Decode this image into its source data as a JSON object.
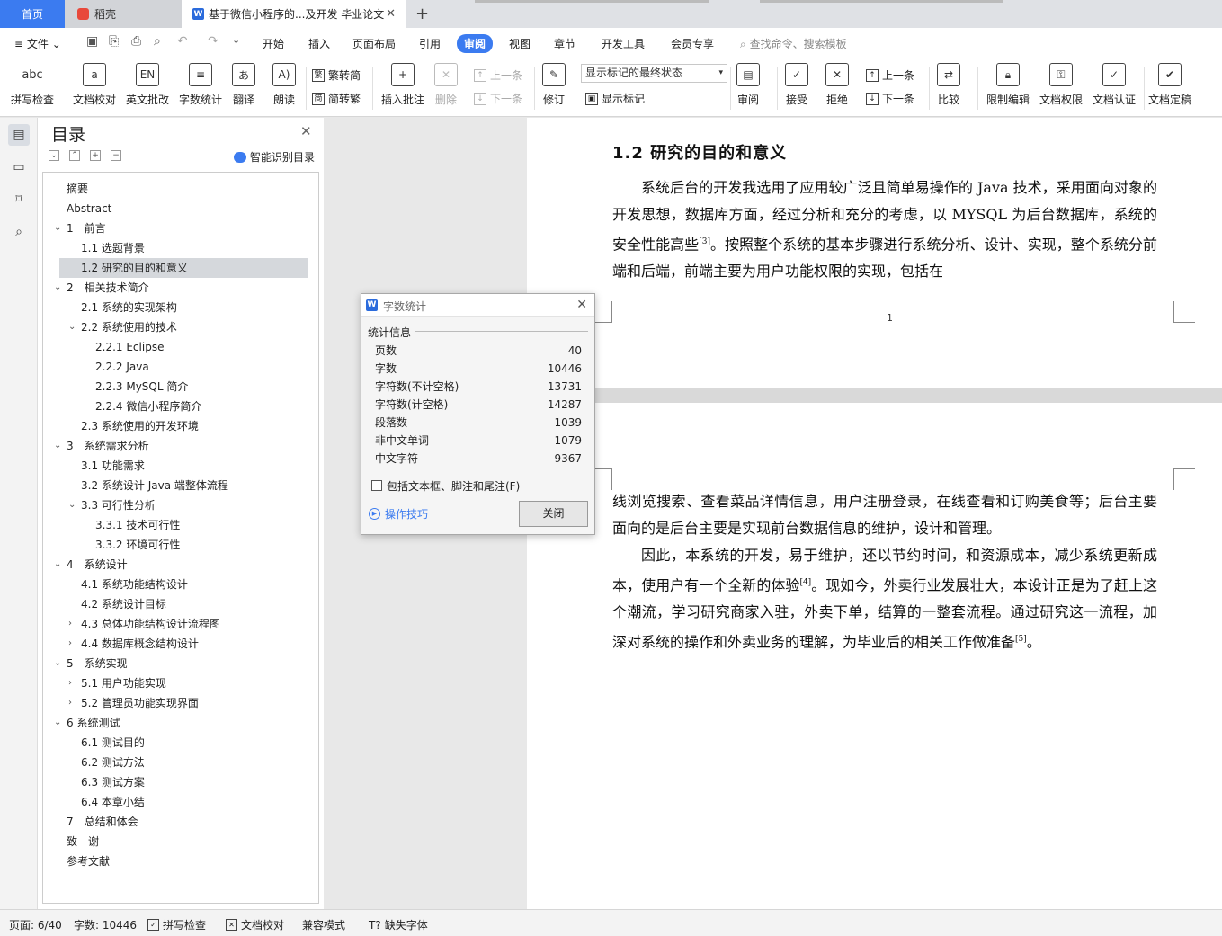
{
  "tabs": {
    "home": "首页",
    "dao": "稻壳",
    "doc": "基于微信小程序的...及开发 毕业论文",
    "plus": "+"
  },
  "menu": {
    "file": "文件",
    "items": [
      "开始",
      "插入",
      "页面布局",
      "引用",
      "审阅",
      "视图",
      "章节",
      "开发工具",
      "会员专享"
    ],
    "active": "审阅",
    "search": "查找命令、搜索模板"
  },
  "ribbon": {
    "spell": "拼写检查",
    "proof": "文档校对",
    "en": "英文批改",
    "count": "字数统计",
    "trans": "翻译",
    "read": "朗读",
    "trad": "繁转简",
    "simp": "简转繁",
    "insert_comment": "插入批注",
    "delete": "删除",
    "prev": "上一条",
    "next": "下一条",
    "revise": "修订",
    "mark_state": "显示标记的最终状态",
    "show_mark": "显示标记",
    "review": "审阅",
    "accept": "接受",
    "reject": "拒绝",
    "prev2": "上一条",
    "next2": "下一条",
    "compare": "比较",
    "restrict": "限制编辑",
    "perm": "文档权限",
    "auth": "文档认证",
    "final": "文档定稿"
  },
  "toc": {
    "title": "目录",
    "smart": "智能识别目录",
    "items": [
      {
        "t": "摘要",
        "lvl": 0,
        "c": ""
      },
      {
        "t": "Abstract",
        "lvl": 0,
        "c": ""
      },
      {
        "t": "1　前言",
        "lvl": 0,
        "c": "v"
      },
      {
        "t": "1.1  选题背景",
        "lvl": 1,
        "c": ""
      },
      {
        "t": "1.2  研究的目的和意义",
        "lvl": 1,
        "c": "",
        "sel": true
      },
      {
        "t": "2　相关技术简介",
        "lvl": 0,
        "c": "v"
      },
      {
        "t": "2.1  系统的实现架构",
        "lvl": 1,
        "c": ""
      },
      {
        "t": "2.2  系统使用的技术",
        "lvl": 1,
        "c": "v"
      },
      {
        "t": "2.2.1 Eclipse",
        "lvl": 2,
        "c": ""
      },
      {
        "t": "2.2.2 Java",
        "lvl": 2,
        "c": ""
      },
      {
        "t": "2.2.3 MySQL 简介",
        "lvl": 2,
        "c": ""
      },
      {
        "t": "2.2.4  微信小程序简介",
        "lvl": 2,
        "c": ""
      },
      {
        "t": "2.3  系统使用的开发环境",
        "lvl": 1,
        "c": ""
      },
      {
        "t": "3　系统需求分析",
        "lvl": 0,
        "c": "v"
      },
      {
        "t": "3.1  功能需求",
        "lvl": 1,
        "c": ""
      },
      {
        "t": "3.2 系统设计 Java 端整体流程",
        "lvl": 1,
        "c": ""
      },
      {
        "t": "3.3  可行性分析",
        "lvl": 1,
        "c": "v"
      },
      {
        "t": "3.3.1 技术可行性",
        "lvl": 2,
        "c": ""
      },
      {
        "t": "3.3.2 环境可行性",
        "lvl": 2,
        "c": ""
      },
      {
        "t": "4　系统设计",
        "lvl": 0,
        "c": "v"
      },
      {
        "t": "4.1 系统功能结构设计",
        "lvl": 1,
        "c": ""
      },
      {
        "t": "4.2 系统设计目标",
        "lvl": 1,
        "c": ""
      },
      {
        "t": "4.3 总体功能结构设计流程图",
        "lvl": 1,
        "c": ">"
      },
      {
        "t": "4.4 数据库概念结构设计",
        "lvl": 1,
        "c": ">"
      },
      {
        "t": "5　系统实现",
        "lvl": 0,
        "c": "v"
      },
      {
        "t": "5.1 用户功能实现",
        "lvl": 1,
        "c": ">"
      },
      {
        "t": "5.2 管理员功能实现界面",
        "lvl": 1,
        "c": ">"
      },
      {
        "t": "6 系统测试",
        "lvl": 0,
        "c": "v"
      },
      {
        "t": "6.1 测试目的",
        "lvl": 1,
        "c": ""
      },
      {
        "t": "6.2 测试方法",
        "lvl": 1,
        "c": ""
      },
      {
        "t": "6.3 测试方案",
        "lvl": 1,
        "c": ""
      },
      {
        "t": "6.4 本章小结",
        "lvl": 1,
        "c": ""
      },
      {
        "t": "7　总结和体会",
        "lvl": 0,
        "c": ""
      },
      {
        "t": "致　谢",
        "lvl": 0,
        "c": ""
      },
      {
        "t": "参考文献",
        "lvl": 0,
        "c": ""
      }
    ]
  },
  "doc": {
    "heading": "1.2  研究的目的和意义",
    "p1": "系统后台的开发我选用了应用较广泛且简单易操作的 Java 技术，采用面向对象的开发思想，数据库方面，经过分析和充分的考虑，以 MYSQL 为后台数据库，系统的安全性能高些",
    "ref3": "[3]",
    "p1b": "。按照整个系统的基本步骤进行系统分析、设计、实现，整个系统分前端和后端，前端主要为用户功能权限的实现，包括在",
    "page_num": "1",
    "p2": "线浏览搜索、查看菜品详情信息，用户注册登录，在线查看和订购美食等；后台主要面向的是后台主要是实现前台数据信息的维护，设计和管理。",
    "p3": "因此，本系统的开发，易于维护，还以节约时间，和资源成本，减少系统更新成本，使用户有一个全新的体验",
    "ref4": "[4]",
    "p3b": "。现如今，外卖行业发展壮大，本设计正是为了赶上这个潮流，学习研究商家入驻，外卖下单，结算的一整套流程。通过研究这一流程，加深对系统的操作和外卖业务的理解，为毕业后的相关工作做准备",
    "ref5": "[5]",
    "p3c": "。"
  },
  "dialog": {
    "title": "字数统计",
    "section": "统计信息",
    "stats": [
      {
        "k": "页数",
        "v": "40"
      },
      {
        "k": "字数",
        "v": "10446"
      },
      {
        "k": "字符数(不计空格)",
        "v": "13731"
      },
      {
        "k": "字符数(计空格)",
        "v": "14287"
      },
      {
        "k": "段落数",
        "v": "1039"
      },
      {
        "k": "非中文单词",
        "v": "1079"
      },
      {
        "k": "中文字符",
        "v": "9367"
      }
    ],
    "include": "包括文本框、脚注和尾注(F)",
    "tips": "操作技巧",
    "close": "关闭"
  },
  "status": {
    "page": "页面: 6/40",
    "words": "字数: 10446",
    "spell": "拼写检查",
    "proof": "文档校对",
    "compat": "兼容模式",
    "font": "缺失字体"
  },
  "colors": {
    "accent": "#3b7bf0",
    "brand": "#2b6bdc",
    "dao": "#e8493b"
  }
}
